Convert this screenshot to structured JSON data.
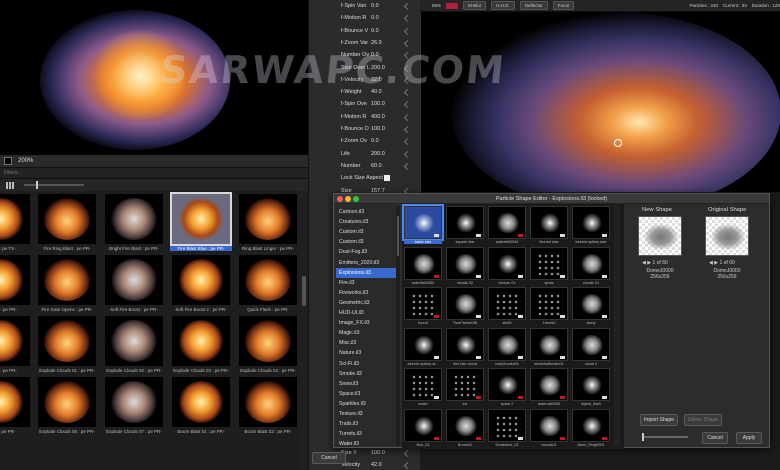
{
  "left": {
    "zoom": "200%",
    "search_placeholder": "Filters...",
    "library": [
      {
        "label": "mplex : pe TS-"
      },
      {
        "label": "Fire Ring Blast : pe PR-"
      },
      {
        "label": "Bright Fire Blast : pe PR-"
      },
      {
        "label": "Fire Blast Blue : pe PR-",
        "selected": true
      },
      {
        "label": "Ring Blast Linger : pe PR-"
      },
      {
        "label": "t Quick : pe PR-"
      },
      {
        "label": "Fire Gate Opens : pe PR-"
      },
      {
        "label": "Soft Fire Boost : pe PR-"
      },
      {
        "label": "Soft Fire Boost 2 : pe PR-"
      },
      {
        "label": "Quick Flash : pe PR-"
      },
      {
        "label": "Smoke : pe PR-"
      },
      {
        "label": "Explode Clouds 01 : pe PR-"
      },
      {
        "label": "Explode Clouds 02 : pe PR-"
      },
      {
        "label": "Explode Clouds 03 : pe PR-"
      },
      {
        "label": "Explode Clouds 04 : pe PR-"
      },
      {
        "label": "ds 05 : pe PR-"
      },
      {
        "label": "Explode Clouds 06 : pe PR-"
      },
      {
        "label": "Explode Clouds 07 : pe PR-"
      },
      {
        "label": "Boom Blast 01 : pe PR-"
      },
      {
        "label": "Boom Blast 02 : pe PR-"
      }
    ]
  },
  "props": [
    {
      "label": "f-Spin Vari",
      "value": "0.0"
    },
    {
      "label": "f-Motion R",
      "value": "0.0",
      "extra": "ction"
    },
    {
      "label": "f-Bounce V",
      "value": "0.0"
    },
    {
      "label": "f-Zoom Var",
      "value": "26.9"
    },
    {
      "label": "Number Ov",
      "value": "0.0"
    },
    {
      "label": "Size Over L",
      "value": "200.0"
    },
    {
      "label": "f-Velocity",
      "value": "22.0"
    },
    {
      "label": "f-Weight",
      "value": "40.0"
    },
    {
      "label": "f-Spin Ove",
      "value": "100.0"
    },
    {
      "label": "f-Motion R",
      "value": "400.0"
    },
    {
      "label": "f-Bounce O",
      "value": "100.0"
    },
    {
      "label": "f-Zoom Ov",
      "value": "0.0"
    },
    {
      "label": "Life",
      "value": "200.0"
    },
    {
      "label": "Number",
      "value": "60.0"
    },
    {
      "label": "Lock Size Aspect",
      "value": "",
      "check": true
    },
    {
      "label": "Size",
      "value": "157.7"
    },
    {
      "label": "Velocity",
      "value": "163.1"
    },
    {
      "label": "Weight",
      "value": "206.9"
    },
    {
      "label": "Spin",
      "value": "100.0"
    },
    {
      "label": "Motion Ra",
      "value": "98.5"
    }
  ],
  "props_bottom": [
    {
      "label": "Size Y",
      "value": "100.0"
    },
    {
      "label": "Velocity",
      "value": "42.0"
    }
  ],
  "viewport": {
    "zoom": "85%",
    "mblur": "M-Blur",
    "hud": "H.U.D.",
    "deflector": "Deflector",
    "force": "Force",
    "particles": "Particles : 240",
    "current": "Current : 33",
    "duration": "Duration : 120"
  },
  "watermark": "SARWAPC.COM",
  "dialog": {
    "title": "Particle Shape Editor - Explosions.il3 (locked)",
    "categories": [
      "Cartoon.il3",
      "Creatures.il3",
      "Custom.il3",
      "Custom.il3",
      "Dust-Fog.il3",
      "Emitters_2020.il3",
      "Explosions.il3",
      "Fire.il3",
      "Fireworks.il3",
      "Geometric.il3",
      "HUD-UI.il3",
      "Image_FX.il3",
      "Magic.il3",
      "Misc.il3",
      "Nature.il3",
      "Sci-Fi.il3",
      "Smoke.il3",
      "Snow.il3",
      "Space.il3",
      "Sparkles.il3",
      "Texture.il3",
      "Trails.il3",
      "Turrets.il3",
      "Water.il3"
    ],
    "selected_category": "Explosions.il3",
    "shapes": [
      {
        "name": "basic star",
        "type": "glow",
        "flag": "w",
        "selected": true
      },
      {
        "name": "square star",
        "type": "glow",
        "flag": "w"
      },
      {
        "name": "waterfall0040",
        "type": "blot",
        "flag": "r"
      },
      {
        "name": "blurred star",
        "type": "glow",
        "flag": "w"
      },
      {
        "name": "blurred spikey star",
        "type": "glow",
        "flag": "w"
      },
      {
        "name": "waterfall0080",
        "type": "blot",
        "flag": "r"
      },
      {
        "name": "clouds 02",
        "type": "blot",
        "flag": "w"
      },
      {
        "name": "texture 01",
        "type": "glow",
        "flag": "w"
      },
      {
        "name": "spots",
        "type": "dots",
        "flag": "w"
      },
      {
        "name": "clouds 01",
        "type": "blot",
        "flag": "w"
      },
      {
        "name": "found",
        "type": "dots",
        "flag": "r"
      },
      {
        "name": "TrueFlame196",
        "type": "blot",
        "flag": "w"
      },
      {
        "name": "sfx06",
        "type": "dots",
        "flag": "w"
      },
      {
        "name": "f-trees0",
        "type": "dots",
        "flag": "w"
      },
      {
        "name": "stony",
        "type": "blot",
        "flag": "w"
      },
      {
        "name": "blurred spikey st...",
        "type": "glow",
        "flag": "w"
      },
      {
        "name": "dim blur cloud",
        "type": "glow",
        "flag": "w"
      },
      {
        "name": "curlySmoke01",
        "type": "blot",
        "flag": "w"
      },
      {
        "name": "amoeba5moke01",
        "type": "blot",
        "flag": "w"
      },
      {
        "name": "cloud 2",
        "type": "blot",
        "flag": "w"
      },
      {
        "name": "crash",
        "type": "dots",
        "flag": "w"
      },
      {
        "name": "ice",
        "type": "dots",
        "flag": "r"
      },
      {
        "name": "spark 2",
        "type": "glow",
        "flag": "r"
      },
      {
        "name": "asteroid0000",
        "type": "blot",
        "flag": "r"
      },
      {
        "name": "Alpha_line0",
        "type": "glow",
        "flag": "w"
      },
      {
        "name": "Blur_01",
        "type": "glow",
        "flag": "r"
      },
      {
        "name": "Boom01",
        "type": "blot",
        "flag": "r"
      },
      {
        "name": "Scratches_01",
        "type": "dots",
        "flag": "w"
      },
      {
        "name": "clouds01",
        "type": "blot",
        "flag": "r"
      },
      {
        "name": "Atom_Ring0001",
        "type": "glow",
        "flag": "r"
      }
    ],
    "new_shape_title": "New Shape",
    "original_shape_title": "Original Shape",
    "new_nav": "◀ ▶  1 of 60",
    "orig_nav": "◀ ▶  1 of 60",
    "new_name": "DomeJ0000",
    "new_dim": "256x256",
    "orig_name": "DomeJ0000",
    "orig_dim": "256x256",
    "import_label": "Import Shape",
    "delete_label": "Delete Shape",
    "cancel_label": "Cancel",
    "apply_label": "Apply"
  },
  "bottom": {
    "cancel_label": "Cancel"
  },
  "colors": {
    "accent": "#3a6ad0",
    "blast_orange": "#e0742a",
    "record_red": "#b0203a"
  }
}
